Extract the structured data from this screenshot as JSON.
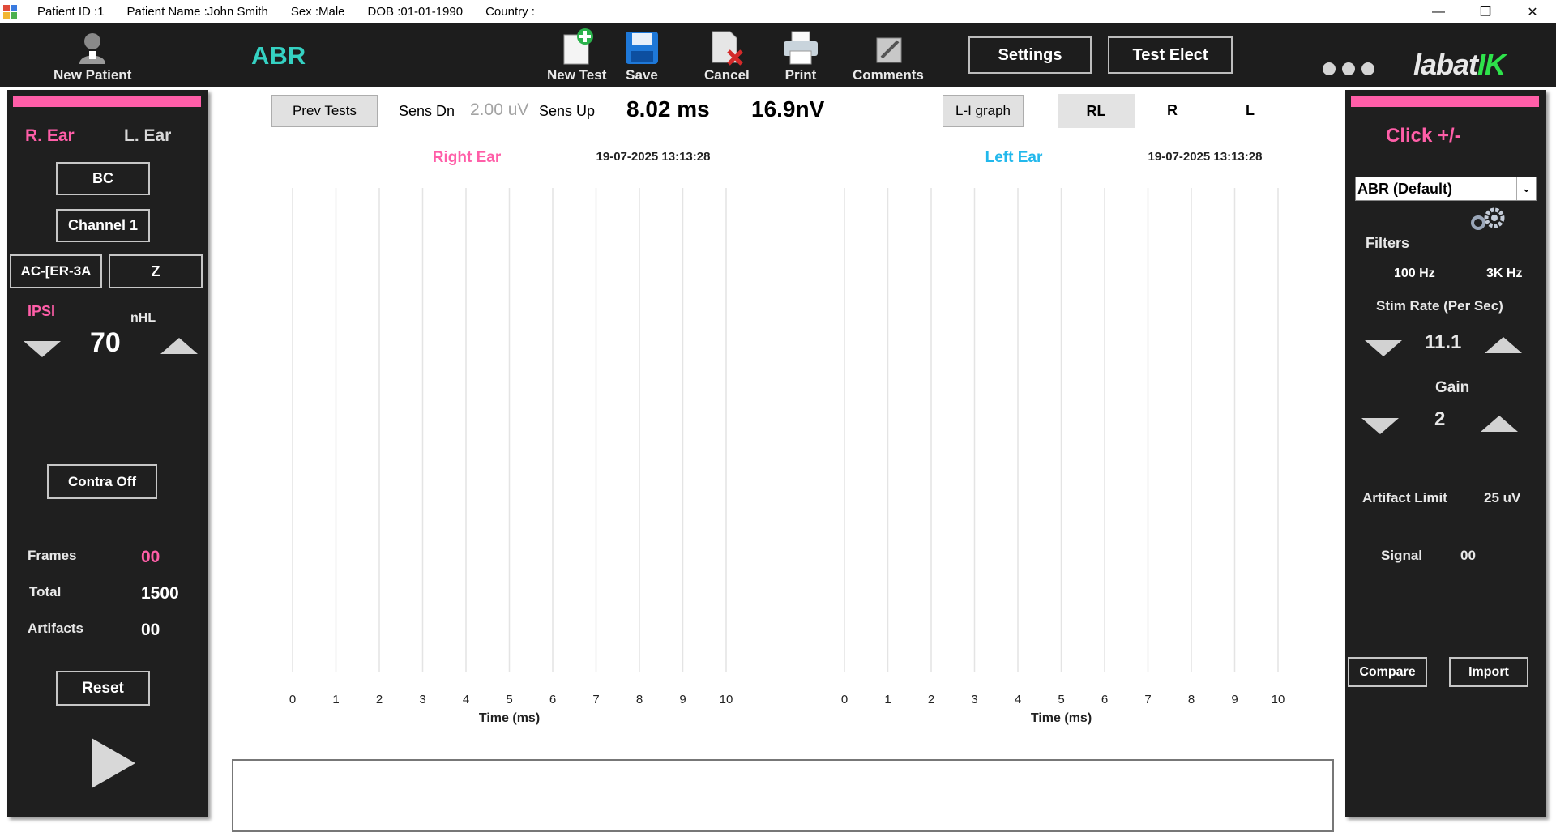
{
  "titlebar": {
    "patient_id": "Patient ID :1",
    "patient_name": "Patient Name :John Smith",
    "sex": "Sex :Male",
    "dob": "DOB :01-01-1990",
    "country": "Country :",
    "minimize": "—",
    "restore": "❐",
    "close": "✕"
  },
  "toolbar": {
    "new_patient": "New Patient",
    "module_title": "ABR",
    "new_test": "New Test",
    "save": "Save",
    "cancel": "Cancel",
    "print": "Print",
    "comments": "Comments",
    "settings": "Settings",
    "test_elect": "Test Elect",
    "logo_text": "labat",
    "logo_accent": "IK"
  },
  "left_panel": {
    "r_ear": "R. Ear",
    "l_ear": "L. Ear",
    "bc": "BC",
    "channel": "Channel 1",
    "transducer": "AC-[ER-3A",
    "z": "Z",
    "ipsi": "IPSI",
    "nhl": "nHL",
    "level": "70",
    "contra": "Contra Off",
    "frames_label": "Frames",
    "frames_value": "00",
    "total_label": "Total",
    "total_value": "1500",
    "artifacts_label": "Artifacts",
    "artifacts_value": "00",
    "reset": "Reset"
  },
  "center_bar": {
    "prev_tests": "Prev Tests",
    "sens_dn": "Sens Dn",
    "sens_value": "2.00 uV",
    "sens_up": "Sens Up",
    "time_value": "8.02 ms",
    "amp_value": "16.9nV",
    "li_graph": "L-I graph",
    "rl": "RL",
    "r": "R",
    "l": "L"
  },
  "chart_data": [
    {
      "type": "line",
      "title": "Right Ear",
      "timestamp": "19-07-2025 13:13:28",
      "xlabel": "Time (ms)",
      "x_ticks": [
        "0",
        "1",
        "2",
        "3",
        "4",
        "5",
        "6",
        "7",
        "8",
        "9",
        "10"
      ],
      "xlim": [
        0,
        10
      ],
      "grid": true,
      "series": []
    },
    {
      "type": "line",
      "title": "Left Ear",
      "timestamp": "19-07-2025 13:13:28",
      "xlabel": "Time (ms)",
      "x_ticks": [
        "0",
        "1",
        "2",
        "3",
        "4",
        "5",
        "6",
        "7",
        "8",
        "9",
        "10"
      ],
      "xlim": [
        0,
        10
      ],
      "grid": true,
      "series": []
    }
  ],
  "right_panel": {
    "stimulus": "Click +/-",
    "protocol": "ABR (Default)",
    "filters_label": "Filters",
    "filter_low": "100 Hz",
    "filter_high": "3K Hz",
    "stim_rate_label": "Stim Rate (Per Sec)",
    "stim_rate_value": "11.1",
    "gain_label": "Gain",
    "gain_value": "2",
    "artifact_limit_label": "Artifact Limit",
    "artifact_limit_value": "25 uV",
    "signal_label": "Signal",
    "signal_value": "00",
    "compare": "Compare",
    "import": "Import"
  },
  "colors": {
    "pink": "#ff5ea8",
    "cyan": "#35d1c2",
    "left_ear_blue": "#22b8ec",
    "panel_bg": "#1f1f1f"
  }
}
